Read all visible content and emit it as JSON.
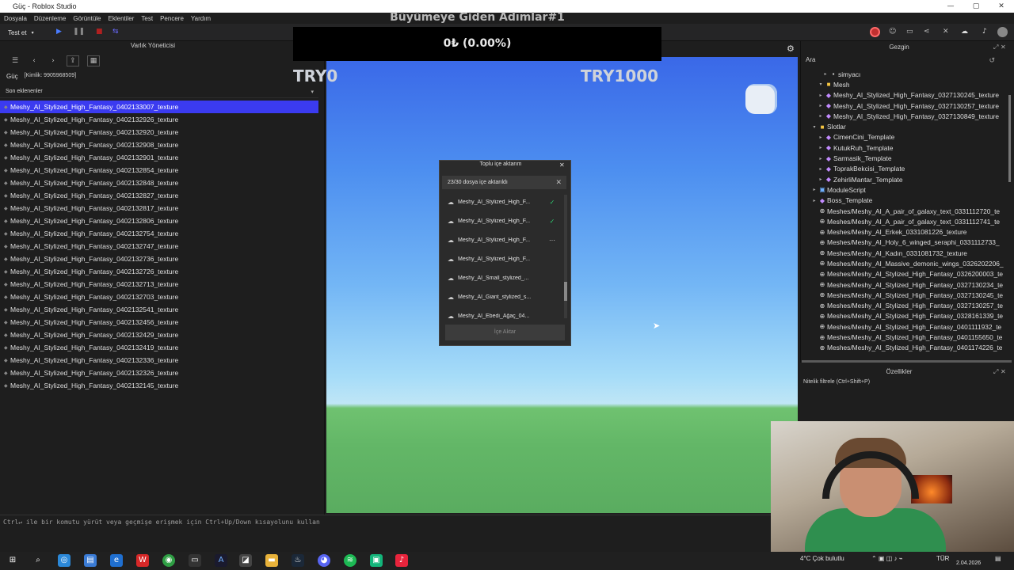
{
  "window": {
    "title": "Güç - Roblox Studio",
    "minimize": "—",
    "maximize": "▢",
    "close": "✕"
  },
  "menu": [
    "Dosyala",
    "Düzenleme",
    "Görüntüle",
    "Eklentiler",
    "Test",
    "Pencere",
    "Yardım"
  ],
  "toolbar": {
    "test_dropdown": "Test et"
  },
  "asset_manager": {
    "title": "Varlık Yöneticisi",
    "breadcrumb": "Güç",
    "breadcrumb_id": "[Kimlik: 9905968509]",
    "section": "Son eklenenler",
    "items": [
      "Meshy_AI_Stylized_High_Fantasy_0402133007_texture",
      "Meshy_AI_Stylized_High_Fantasy_0402132926_texture",
      "Meshy_AI_Stylized_High_Fantasy_0402132920_texture",
      "Meshy_AI_Stylized_High_Fantasy_0402132908_texture",
      "Meshy_AI_Stylized_High_Fantasy_0402132901_texture",
      "Meshy_AI_Stylized_High_Fantasy_0402132854_texture",
      "Meshy_AI_Stylized_High_Fantasy_0402132848_texture",
      "Meshy_AI_Stylized_High_Fantasy_0402132827_texture",
      "Meshy_AI_Stylized_High_Fantasy_0402132817_texture",
      "Meshy_AI_Stylized_High_Fantasy_0402132806_texture",
      "Meshy_AI_Stylized_High_Fantasy_0402132754_texture",
      "Meshy_AI_Stylized_High_Fantasy_0402132747_texture",
      "Meshy_AI_Stylized_High_Fantasy_0402132736_texture",
      "Meshy_AI_Stylized_High_Fantasy_0402132726_texture",
      "Meshy_AI_Stylized_High_Fantasy_0402132713_texture",
      "Meshy_AI_Stylized_High_Fantasy_0402132703_texture",
      "Meshy_AI_Stylized_High_Fantasy_0402132541_texture",
      "Meshy_AI_Stylized_High_Fantasy_0402132456_texture",
      "Meshy_AI_Stylized_High_Fantasy_0402132429_texture",
      "Meshy_AI_Stylized_High_Fantasy_0402132419_texture",
      "Meshy_AI_Stylized_High_Fantasy_0402132336_texture",
      "Meshy_AI_Stylized_High_Fantasy_0402132326_texture",
      "Meshy_AI_Stylized_High_Fantasy_0402132145_texture"
    ]
  },
  "viewport": {
    "game_title": "Büyümeye Giden Adımlar#1",
    "money": "0₺ (0.00%)",
    "left_label": "TRY0",
    "right_label": "TRY1000"
  },
  "import_dialog": {
    "title": "Toplu içe aktarım",
    "status": "23/30 dosya içe aktarıldı",
    "rows": [
      {
        "name": "Meshy_AI_Stylized_High_F...",
        "state": "✓"
      },
      {
        "name": "Meshy_AI_Stylized_High_F...",
        "state": "✓"
      },
      {
        "name": "Meshy_AI_Stylized_High_F...",
        "state": "···"
      },
      {
        "name": "Meshy_AI_Stylized_High_F...",
        "state": ""
      },
      {
        "name": "Meshy_AI_Small_stylized_...",
        "state": ""
      },
      {
        "name": "Meshy_AI_Giant_stylized_s...",
        "state": ""
      },
      {
        "name": "Meshy_AI_Ebedi_Ağaç_04...",
        "state": ""
      }
    ],
    "button": "İçe Aktar"
  },
  "explorer": {
    "title": "Gezgin",
    "search_placeholder": "Ara",
    "rows": [
      "simyacı",
      "Mesh",
      "Meshy_AI_Stylized_High_Fantasy_0327130245_texture",
      "Meshy_AI_Stylized_High_Fantasy_0327130257_texture",
      "Meshy_AI_Stylized_High_Fantasy_0327130849_texture",
      "Slotlar",
      "CimenCini_Template",
      "KutukRuh_Template",
      "Sarmasik_Template",
      "ToprakBekcisi_Template",
      "ZehirliMantar_Template",
      "ModuleScript",
      "Boss_Template",
      "Meshes/Meshy_AI_A_pair_of_galaxy_text_0331112720_te",
      "Meshes/Meshy_AI_A_pair_of_galaxy_text_0331112741_te",
      "Meshes/Meshy_AI_Erkek_0331081226_texture",
      "Meshes/Meshy_AI_Holy_6_winged_seraphi_0331112733_",
      "Meshes/Meshy_AI_Kadın_0331081732_texture",
      "Meshes/Meshy_AI_Massive_demonic_wings_0326202206_",
      "Meshes/Meshy_AI_Stylized_High_Fantasy_0326200003_te",
      "Meshes/Meshy_AI_Stylized_High_Fantasy_0327130234_te",
      "Meshes/Meshy_AI_Stylized_High_Fantasy_0327130245_te",
      "Meshes/Meshy_AI_Stylized_High_Fantasy_0327130257_te",
      "Meshes/Meshy_AI_Stylized_High_Fantasy_0328161339_te",
      "Meshes/Meshy_AI_Stylized_High_Fantasy_0401111932_te",
      "Meshes/Meshy_AI_Stylized_High_Fantasy_0401155650_te",
      "Meshes/Meshy_AI_Stylized_High_Fantasy_0401174226_te"
    ]
  },
  "properties": {
    "title": "Özellikler",
    "filter_placeholder": "Nitelik filtrele (Ctrl+Shift+P)"
  },
  "command_bar": {
    "placeholder": "Ctrl↵ ile bir komutu yürüt veya geçmişe erişmek için Ctrl+Up/Down kısayolunu kullan"
  },
  "taskbar": {
    "weather": "4°C  Çok bulutlu",
    "lang": "TÜR",
    "date": "2.04.2026"
  }
}
